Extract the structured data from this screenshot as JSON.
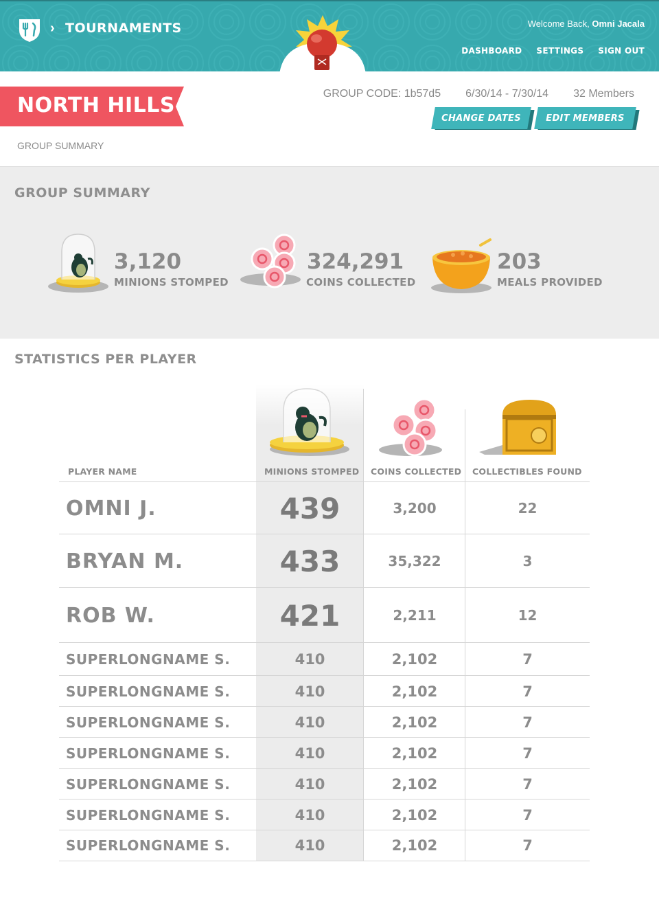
{
  "header": {
    "breadcrumb_title": "TOURNAMENTS",
    "welcome_prefix": "Welcome Back, ",
    "user_name": "Omni Jacala",
    "nav": [
      "DASHBOARD",
      "SETTINGS",
      "SIGN OUT"
    ],
    "icons": [
      "fork-knife-shield-logo",
      "chevron-right-icon",
      "boxing-glove-icon"
    ]
  },
  "group": {
    "name": "NORTH HILLS",
    "subtitle": "GROUP SUMMARY",
    "code": "GROUP CODE: 1b57d5",
    "dates": "6/30/14 - 7/30/14",
    "members": "32 Members",
    "change_dates_label": "CHANGE DATES",
    "edit_members_label": "EDIT MEMBERS"
  },
  "summary": {
    "heading": "GROUP SUMMARY",
    "stats": [
      {
        "value": "3,120",
        "label": "MINIONS STOMPED",
        "icon": "minion-dome-icon"
      },
      {
        "value": "324,291",
        "label": "COINS COLLECTED",
        "icon": "coin-pile-icon"
      },
      {
        "value": "203",
        "label": "MEALS PROVIDED",
        "icon": "meal-bowl-icon"
      }
    ]
  },
  "players": {
    "heading": "STATISTICS PER PLAYER",
    "columns": [
      "PLAYER NAME",
      "MINIONS STOMPED",
      "COINS COLLECTED",
      "COLLECTIBLES FOUND"
    ],
    "rows": [
      {
        "name": "OMNI J.",
        "minions": "439",
        "coins": "3,200",
        "collectibles": "22"
      },
      {
        "name": "BRYAN M.",
        "minions": "433",
        "coins": "35,322",
        "collectibles": "3"
      },
      {
        "name": "ROB W.",
        "minions": "421",
        "coins": "2,211",
        "collectibles": "12"
      },
      {
        "name": "SUPERLONGNAME S.",
        "minions": "410",
        "coins": "2,102",
        "collectibles": "7"
      },
      {
        "name": "SUPERLONGNAME S.",
        "minions": "410",
        "coins": "2,102",
        "collectibles": "7"
      },
      {
        "name": "SUPERLONGNAME S.",
        "minions": "410",
        "coins": "2,102",
        "collectibles": "7"
      },
      {
        "name": "SUPERLONGNAME S.",
        "minions": "410",
        "coins": "2,102",
        "collectibles": "7"
      },
      {
        "name": "SUPERLONGNAME S.",
        "minions": "410",
        "coins": "2,102",
        "collectibles": "7"
      },
      {
        "name": "SUPERLONGNAME S.",
        "minions": "410",
        "coins": "2,102",
        "collectibles": "7"
      },
      {
        "name": "SUPERLONGNAME S.",
        "minions": "410",
        "coins": "2,102",
        "collectibles": "7"
      }
    ]
  },
  "colors": {
    "header_teal": "#37a9ae",
    "banner_red": "#ef5560",
    "button_teal": "#3fb5ba",
    "text_gray": "#8a8a8a",
    "summary_bg": "#ededed"
  }
}
